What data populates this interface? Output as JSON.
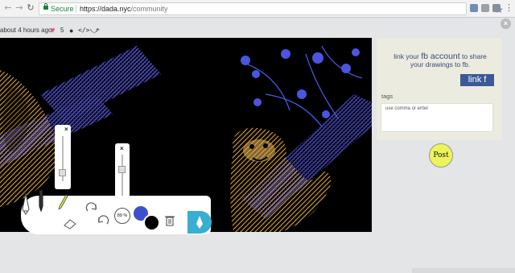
{
  "browser": {
    "secure_label": "Secure",
    "url_host": "https://dada.nyc",
    "url_path": "/community"
  },
  "meta": {
    "time_ago": "about 4 hours ago",
    "like_count": "5"
  },
  "sidebar": {
    "fb_line1_a": "link your ",
    "fb_line1_b": "fb account",
    "fb_line1_c": " to share",
    "fb_line2": "your drawings to fb.",
    "fb_button": "link f",
    "tags_label": "tags",
    "tags_placeholder": "use comma or enter"
  },
  "post_button": "Post",
  "toolbar": {
    "opacity_percent": "89 %",
    "brush_size_level": 0.2,
    "opacity_level": 0.65,
    "colors": {
      "primary": "#3d4fd0",
      "secondary": "#000000",
      "send": "#38afd0"
    }
  }
}
